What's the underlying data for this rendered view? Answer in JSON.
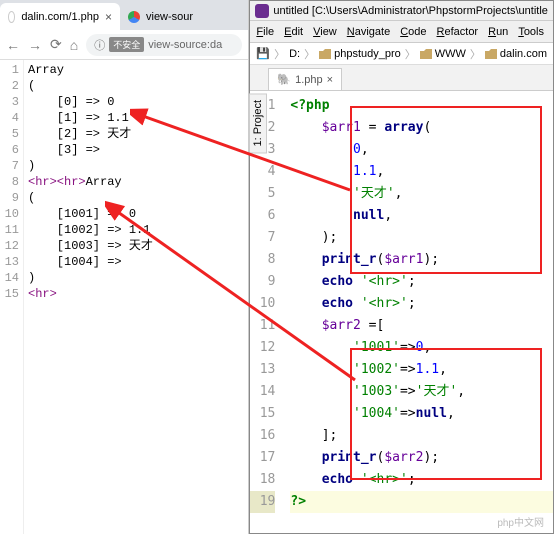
{
  "browser": {
    "tabs": [
      {
        "title": "dalin.com/1.php",
        "active": true
      },
      {
        "title": "view-sour",
        "active": false
      }
    ],
    "url_badge": "不安全",
    "url": "view-source:da",
    "source_lines": [
      {
        "n": 1,
        "html": "<span class='txt'>Array</span>"
      },
      {
        "n": 2,
        "html": "<span class='txt'>(</span>"
      },
      {
        "n": 3,
        "html": "<span class='txt'>    [0] =&gt; 0</span>"
      },
      {
        "n": 4,
        "html": "<span class='txt'>    [1] =&gt; 1.1</span>"
      },
      {
        "n": 5,
        "html": "<span class='txt'>    [2] =&gt; 天才</span>"
      },
      {
        "n": 6,
        "html": "<span class='txt'>    [3] =&gt; </span>"
      },
      {
        "n": 7,
        "html": "<span class='txt'>)</span>"
      },
      {
        "n": 8,
        "html": "<span class='tag'>&lt;hr&gt;&lt;hr&gt;</span><span class='txt'>Array</span>"
      },
      {
        "n": 9,
        "html": "<span class='txt'>(</span>"
      },
      {
        "n": 10,
        "html": "<span class='txt'>    [1001] =&gt; 0</span>"
      },
      {
        "n": 11,
        "html": "<span class='txt'>    [1002] =&gt; 1.1</span>"
      },
      {
        "n": 12,
        "html": "<span class='txt'>    [1003] =&gt; 天才</span>"
      },
      {
        "n": 13,
        "html": "<span class='txt'>    [1004] =&gt; </span>"
      },
      {
        "n": 14,
        "html": "<span class='txt'>)</span>"
      },
      {
        "n": 15,
        "html": "<span class='tag'>&lt;hr&gt;</span>"
      }
    ]
  },
  "ide": {
    "title": "untitled [C:\\Users\\Administrator\\PhpstormProjects\\untitle",
    "menu": [
      "File",
      "Edit",
      "View",
      "Navigate",
      "Code",
      "Refactor",
      "Run",
      "Tools"
    ],
    "breadcrumbs": [
      "D:",
      "phpstudy_pro",
      "WWW",
      "dalin.com"
    ],
    "tab": {
      "name": "1.php",
      "close": "×"
    },
    "side_tab": "1: Project",
    "lines": [
      {
        "n": 1,
        "html": "<span class='php'>&lt;?php</span>"
      },
      {
        "n": 2,
        "html": "    <span class='var'>$arr1</span> = <span class='kw'>array</span>("
      },
      {
        "n": 3,
        "html": "        <span class='num'>0</span>,"
      },
      {
        "n": 4,
        "html": "        <span class='num'>1.1</span>,"
      },
      {
        "n": 5,
        "html": "        <span class='str'>'天才'</span>,"
      },
      {
        "n": 6,
        "html": "        <span class='kw'>null</span>,"
      },
      {
        "n": 7,
        "html": "    );"
      },
      {
        "n": 8,
        "html": "    <span class='kw'>print_r</span>(<span class='var'>$arr1</span>);"
      },
      {
        "n": 9,
        "html": "    <span class='kw'>echo</span> <span class='str'>'&lt;hr&gt;'</span>;"
      },
      {
        "n": 10,
        "html": "    <span class='kw'>echo</span> <span class='str'>'&lt;hr&gt;'</span>;"
      },
      {
        "n": 11,
        "html": "    <span class='var'>$arr2</span> =["
      },
      {
        "n": 12,
        "html": "        <span class='str'>'1001'</span>=&gt;<span class='num'>0</span>,"
      },
      {
        "n": 13,
        "html": "        <span class='str'>'1002'</span>=&gt;<span class='num'>1.1</span>,"
      },
      {
        "n": 14,
        "html": "        <span class='str'>'1003'</span>=&gt;<span class='str'>'天才'</span>,"
      },
      {
        "n": 15,
        "html": "        <span class='str'>'1004'</span>=&gt;<span class='kw'>null</span>,"
      },
      {
        "n": 16,
        "html": "    ];"
      },
      {
        "n": 17,
        "html": "    <span class='kw'>print_r</span>(<span class='var'>$arr2</span>);"
      },
      {
        "n": 18,
        "html": "    <span class='kw'>echo</span> <span class='str'>'&lt;hr&gt;'</span>;"
      },
      {
        "n": 19,
        "html": "<span class='cur-line'><span class='php'>?&gt;</span></span>",
        "cur": true
      }
    ]
  },
  "watermark": "php中文网"
}
